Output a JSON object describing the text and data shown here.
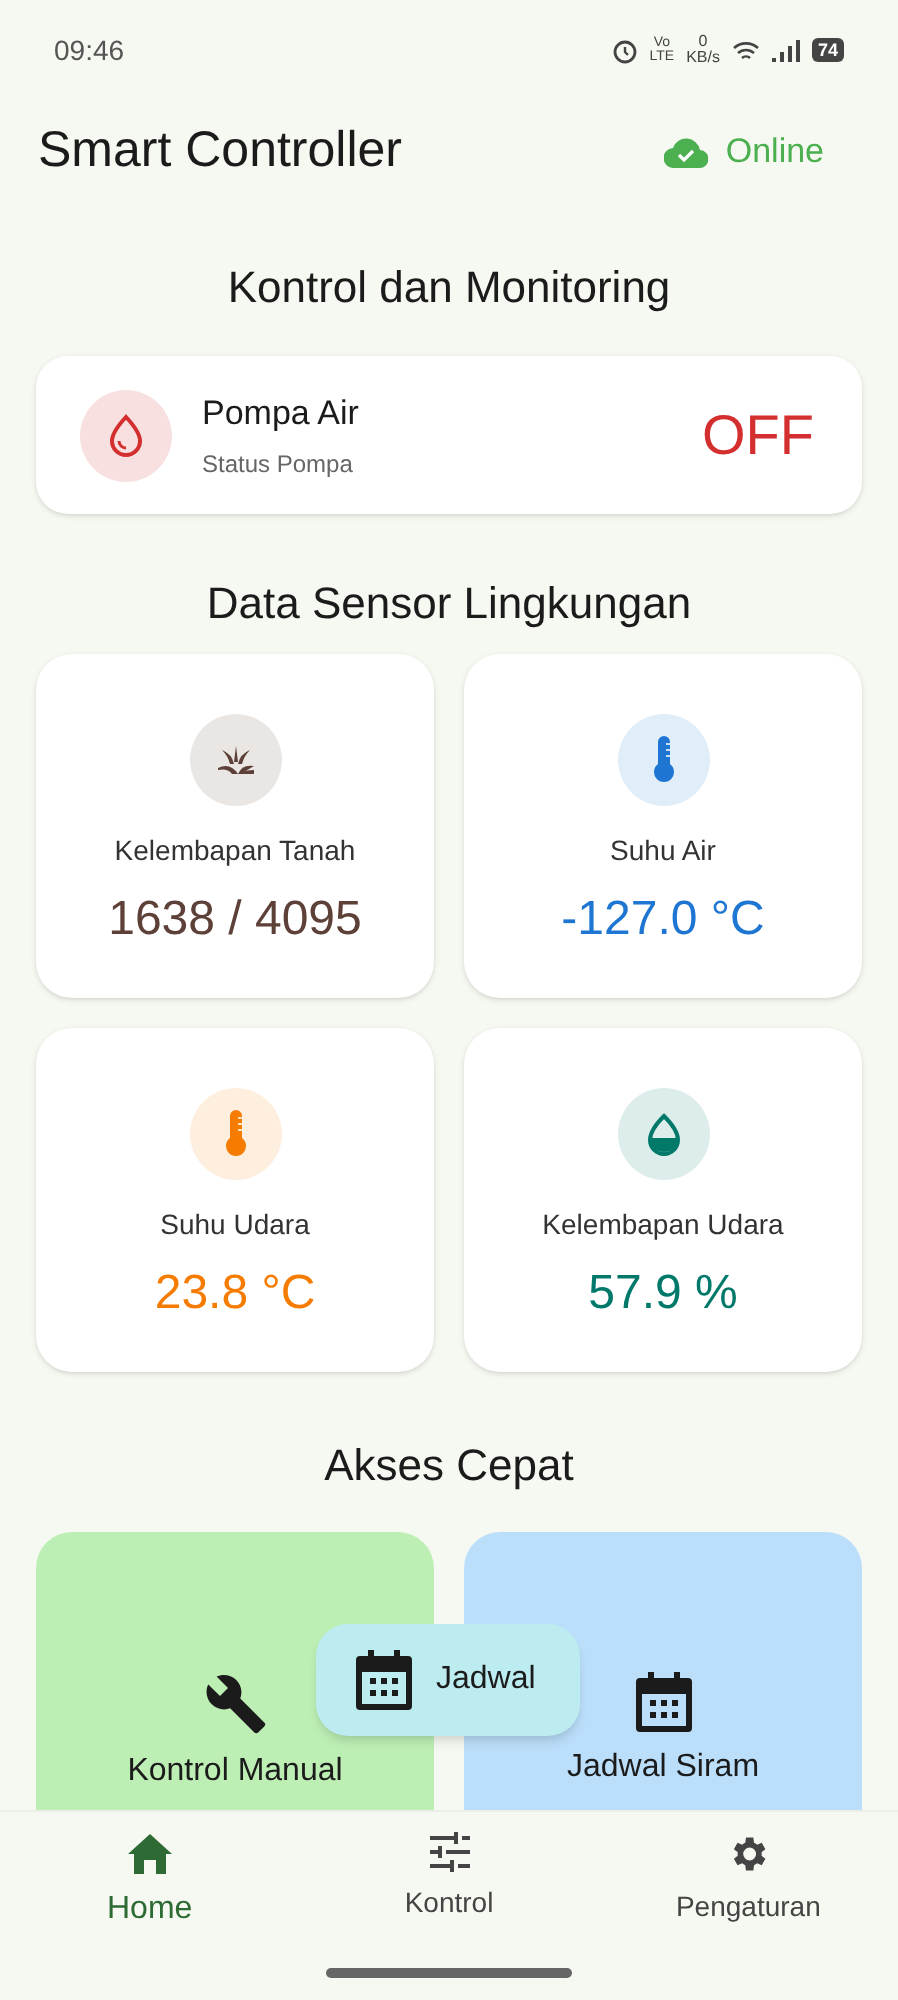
{
  "status_bar": {
    "time": "09:46",
    "volte_top": "Vo",
    "volte_bottom": "LTE",
    "speed_value": "0",
    "speed_unit": "KB/s",
    "battery": "74"
  },
  "header": {
    "title": "Smart Controller",
    "connection": "Online",
    "online": true
  },
  "control_section": {
    "title": "Kontrol dan Monitoring",
    "pump": {
      "name": "Pompa Air",
      "subtitle": "Status Pompa",
      "state": "OFF",
      "on": false
    }
  },
  "sensor_section": {
    "title": "Data Sensor Lingkungan",
    "sensors": [
      {
        "kind": "soil",
        "label": "Kelembapan Tanah",
        "value": "1638 / 4095",
        "color": "#5d4037"
      },
      {
        "kind": "thermometer",
        "label": "Suhu Air",
        "value": "-127.0 °C",
        "color": "#1e76d2"
      },
      {
        "kind": "thermometer",
        "label": "Suhu Udara",
        "value": "23.8 °C",
        "color": "#f57c00"
      },
      {
        "kind": "humidity",
        "label": "Kelembapan Udara",
        "value": "57.9 %",
        "color": "#00796b"
      }
    ]
  },
  "quick_access": {
    "title": "Akses Cepat",
    "items": [
      {
        "kind": "wrench",
        "label": "Kontrol Manual",
        "color": "#bdefb5"
      },
      {
        "kind": "calendar",
        "label": "Jadwal Siram",
        "color": "#bbdefa"
      }
    ]
  },
  "tooltip": {
    "label": "Jadwal"
  },
  "bottom_nav": [
    {
      "kind": "home",
      "label": "Home",
      "selected": true
    },
    {
      "kind": "sliders",
      "label": "Kontrol",
      "selected": false
    },
    {
      "kind": "gear",
      "label": "Pengaturan",
      "selected": false
    }
  ]
}
